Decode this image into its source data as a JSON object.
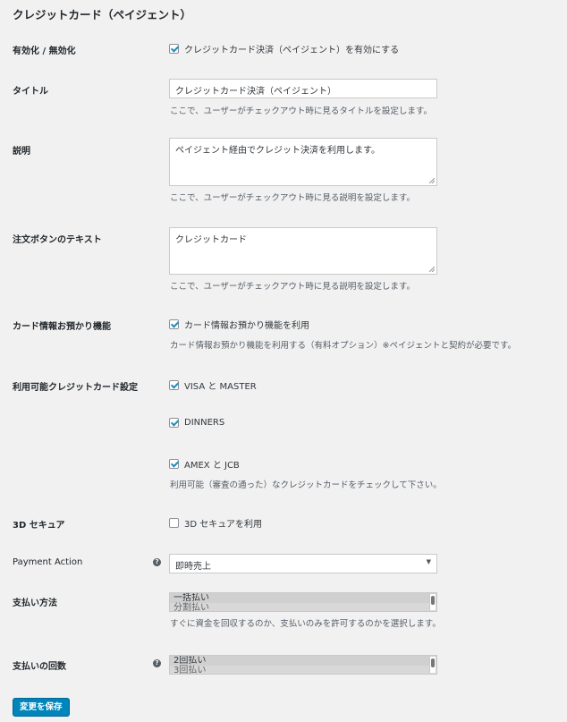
{
  "page_title": "クレジットカード（ペイジェント）",
  "enable": {
    "label": "有効化 / 無効化",
    "checkbox_label": "クレジットカード決済（ペイジェント）を有効にする",
    "checked": true
  },
  "title_field": {
    "label": "タイトル",
    "value": "クレジットカード決済（ペイジェント）",
    "description": "ここで、ユーザーがチェックアウト時に見るタイトルを設定します。"
  },
  "description_field": {
    "label": "説明",
    "value": "ペイジェント経由でクレジット決済を利用します。",
    "description": "ここで、ユーザーがチェックアウト時に見る説明を設定します。"
  },
  "order_button": {
    "label": "注文ボタンのテキスト",
    "value": "クレジットカード",
    "description": "ここで、ユーザーがチェックアウト時に見る説明を設定します。"
  },
  "card_storage": {
    "label": "カード情報お預かり機能",
    "checkbox_label": "カード情報お預かり機能を利用",
    "checked": true,
    "description": "カード情報お預かり機能を利用する（有料オプション）※ペイジェントと契約が必要です。"
  },
  "card_types": {
    "label": "利用可能クレジットカード設定",
    "options": [
      {
        "label": "VISA と MASTER",
        "checked": true
      },
      {
        "label": "DINNERS",
        "checked": true
      },
      {
        "label": "AMEX と JCB",
        "checked": true
      }
    ],
    "description": "利用可能（審査の通った）なクレジットカードをチェックして下さい。"
  },
  "secure3d": {
    "label": "3D セキュア",
    "checkbox_label": "3D セキュアを利用",
    "checked": false
  },
  "payment_action": {
    "label": "Payment Action",
    "help_icon": "?",
    "selected": "即時売上"
  },
  "payment_method": {
    "label": "支払い方法",
    "options": [
      "一括払い",
      "分割払い"
    ],
    "description": "すぐに資金を回収するのか、支払いのみを許可するのかを選択します。"
  },
  "installments": {
    "label": "支払いの回数",
    "help_icon": "?",
    "options": [
      "2回払い",
      "3回払い"
    ]
  },
  "save_button": "変更を保存"
}
